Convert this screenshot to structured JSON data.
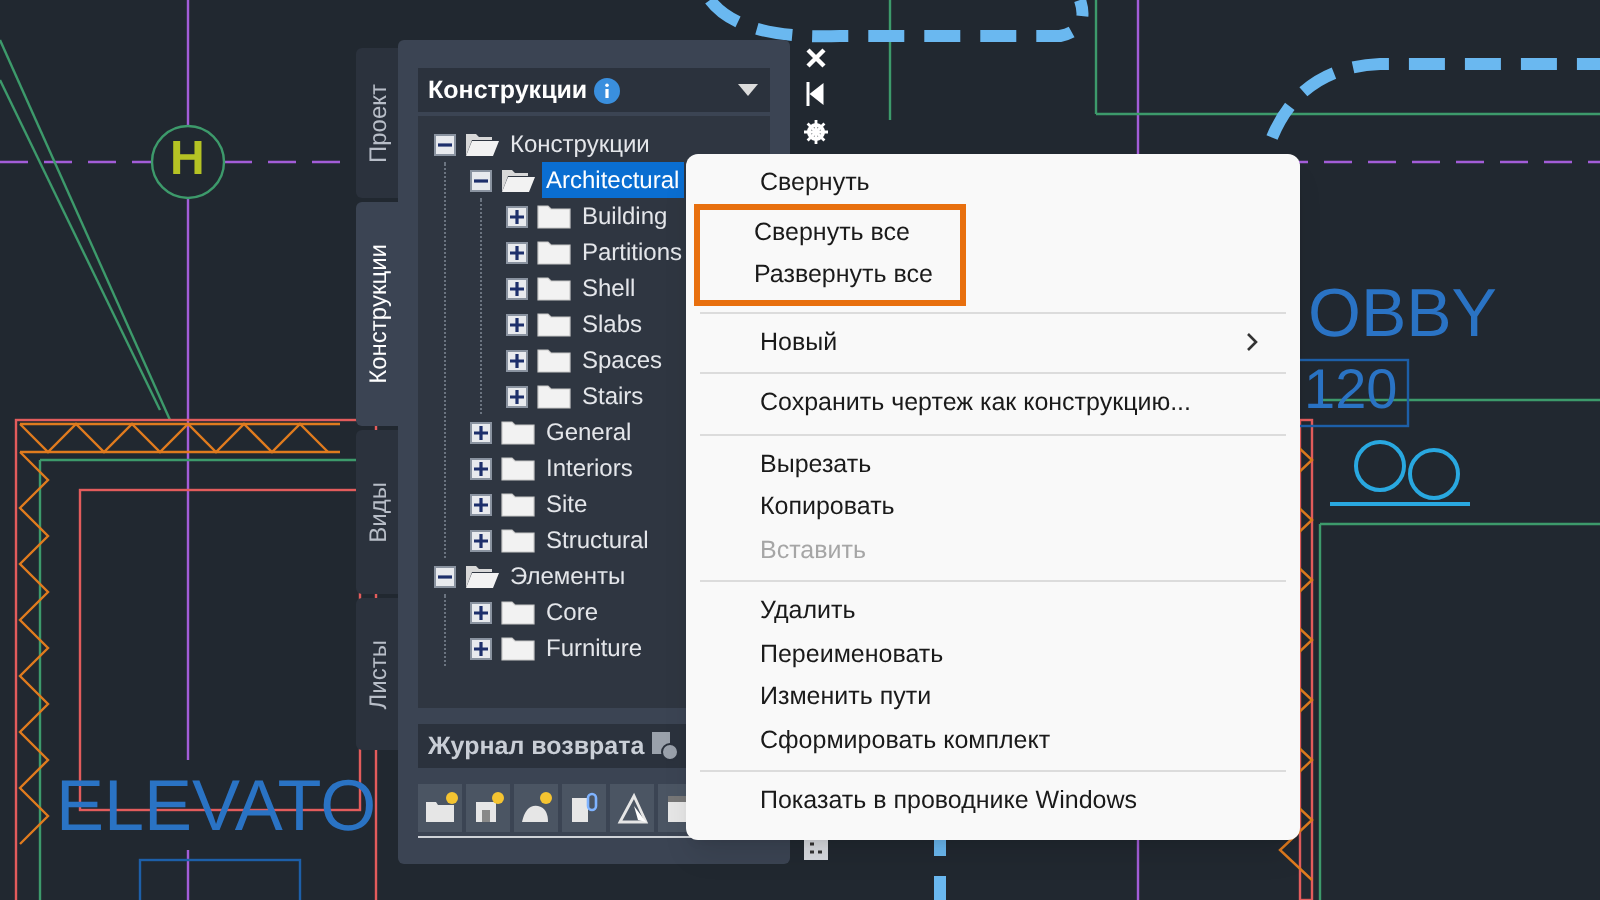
{
  "drawing": {
    "grid_bubble": "H",
    "labels": [
      {
        "text": "OBBY"
      },
      {
        "text": "120"
      },
      {
        "text": "ELEVATO"
      }
    ]
  },
  "palette": {
    "tabs": [
      {
        "label": "Проект",
        "selected": false
      },
      {
        "label": "Конструкции",
        "selected": true
      },
      {
        "label": "Виды",
        "selected": false
      },
      {
        "label": "Листы",
        "selected": false
      }
    ],
    "header": {
      "title": "Конструкции"
    },
    "tree": [
      {
        "label": "Конструкции",
        "expanded": true,
        "selected": false,
        "children": [
          {
            "label": "Architectural",
            "expanded": true,
            "selected": true,
            "children": [
              {
                "label": "Building",
                "expanded": false,
                "selected": false
              },
              {
                "label": "Partitions",
                "expanded": false,
                "selected": false
              },
              {
                "label": "Shell",
                "expanded": false,
                "selected": false
              },
              {
                "label": "Slabs",
                "expanded": false,
                "selected": false
              },
              {
                "label": "Spaces",
                "expanded": false,
                "selected": false
              },
              {
                "label": "Stairs",
                "expanded": false,
                "selected": false
              }
            ]
          },
          {
            "label": "General",
            "expanded": false,
            "selected": false
          },
          {
            "label": "Interiors",
            "expanded": false,
            "selected": false
          },
          {
            "label": "Site",
            "expanded": false,
            "selected": false
          },
          {
            "label": "Structural",
            "expanded": false,
            "selected": false
          }
        ]
      },
      {
        "label": "Элементы",
        "expanded": true,
        "selected": false,
        "children": [
          {
            "label": "Core",
            "expanded": false,
            "selected": false
          },
          {
            "label": "Furniture",
            "expanded": false,
            "selected": false
          }
        ]
      }
    ],
    "journal": {
      "title": "Журнал возврата"
    }
  },
  "context_menu": {
    "sections": [
      {
        "groups": [
          {
            "outlined": false,
            "items": [
              {
                "label": "Свернуть",
                "disabled": false,
                "submenu": false
              }
            ]
          },
          {
            "outlined": true,
            "items": [
              {
                "label": "Свернуть все",
                "disabled": false,
                "submenu": false
              },
              {
                "label": "Развернуть все",
                "disabled": false,
                "submenu": false
              }
            ]
          }
        ]
      },
      {
        "groups": [
          {
            "outlined": false,
            "items": [
              {
                "label": "Новый",
                "disabled": false,
                "submenu": true
              }
            ]
          }
        ]
      },
      {
        "groups": [
          {
            "outlined": false,
            "items": [
              {
                "label": "Сохранить чертеж как конструкцию...",
                "disabled": false,
                "submenu": false
              }
            ]
          }
        ]
      },
      {
        "groups": [
          {
            "outlined": false,
            "items": [
              {
                "label": "Вырезать",
                "disabled": false,
                "submenu": false
              },
              {
                "label": "Копировать",
                "disabled": false,
                "submenu": false
              },
              {
                "label": "Вставить",
                "disabled": true,
                "submenu": false
              }
            ]
          }
        ]
      },
      {
        "groups": [
          {
            "outlined": false,
            "items": [
              {
                "label": "Удалить",
                "disabled": false,
                "submenu": false
              },
              {
                "label": "Переименовать",
                "disabled": false,
                "submenu": false
              },
              {
                "label": "Изменить пути",
                "disabled": false,
                "submenu": false
              },
              {
                "label": "Сформировать комплект",
                "disabled": false,
                "submenu": false
              }
            ]
          }
        ]
      },
      {
        "groups": [
          {
            "outlined": false,
            "items": [
              {
                "label": "Показать в проводнике Windows",
                "disabled": false,
                "submenu": false
              }
            ]
          }
        ]
      }
    ]
  }
}
